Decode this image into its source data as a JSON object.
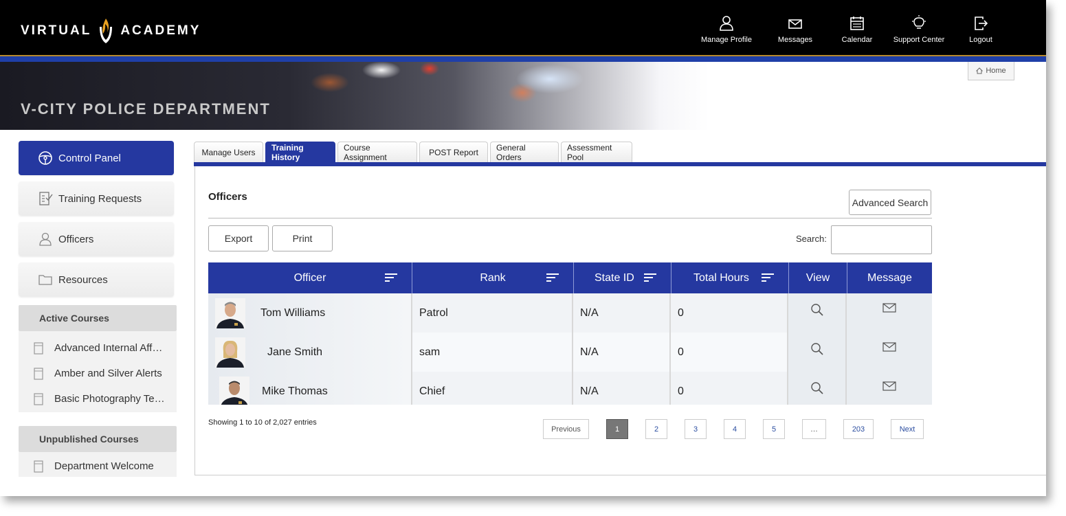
{
  "brand": {
    "left": "VIRTUAL",
    "right": "ACADEMY"
  },
  "topnav": [
    {
      "label": "Manage Profile",
      "icon": "user-icon"
    },
    {
      "label": "Messages",
      "icon": "envelope-icon"
    },
    {
      "label": "Calendar",
      "icon": "calendar-icon"
    },
    {
      "label": "Support Center",
      "icon": "lightbulb-icon"
    },
    {
      "label": "Logout",
      "icon": "logout-icon"
    }
  ],
  "hero": {
    "title": "V-CITY POLICE DEPARTMENT",
    "home_label": "Home"
  },
  "sidebar": {
    "items": [
      {
        "label": "Control Panel",
        "icon": "steering-wheel-icon",
        "active": true
      },
      {
        "label": "Training Requests",
        "icon": "checklist-icon"
      },
      {
        "label": "Officers",
        "icon": "user-icon"
      },
      {
        "label": "Resources",
        "icon": "folder-icon"
      }
    ],
    "active_courses": {
      "heading": "Active Courses",
      "items": [
        "Advanced Internal Affairs",
        "Amber and Silver Alerts",
        "Basic Photography Techniques"
      ]
    },
    "unpublished_courses": {
      "heading": "Unpublished Courses",
      "items": [
        "Department Welcome"
      ]
    }
  },
  "tabs": [
    {
      "label": "Manage Users"
    },
    {
      "label": "Training History",
      "active": true
    },
    {
      "label": "Course Assignment"
    },
    {
      "label": "POST Report"
    },
    {
      "label": "General Orders"
    },
    {
      "label": "Assessment Pool"
    }
  ],
  "main": {
    "title": "Officers",
    "advanced_search_label": "Advanced Search",
    "export_label": "Export",
    "print_label": "Print",
    "search_label": "Search:",
    "search_value": ""
  },
  "table": {
    "columns": [
      "Officer",
      "Rank",
      "State ID",
      "Total Hours",
      "View",
      "Message"
    ],
    "rows": [
      {
        "officer": "Tom Williams",
        "rank": "Patrol",
        "state_id": "N/A",
        "total_hours": "0"
      },
      {
        "officer": "Jane Smith",
        "rank": "sam",
        "state_id": "N/A",
        "total_hours": "0"
      },
      {
        "officer": "Mike Thomas",
        "rank": "Chief",
        "state_id": "N/A",
        "total_hours": "0"
      }
    ]
  },
  "footer": {
    "showing": "Showing 1 to 10 of 2,027 entries",
    "pages": [
      "Previous",
      "1",
      "2",
      "3",
      "4",
      "5",
      "…",
      "203",
      "Next"
    ],
    "current_page": "1"
  },
  "colors": {
    "primary": "#2538a0",
    "gold": "#b88a2c"
  }
}
